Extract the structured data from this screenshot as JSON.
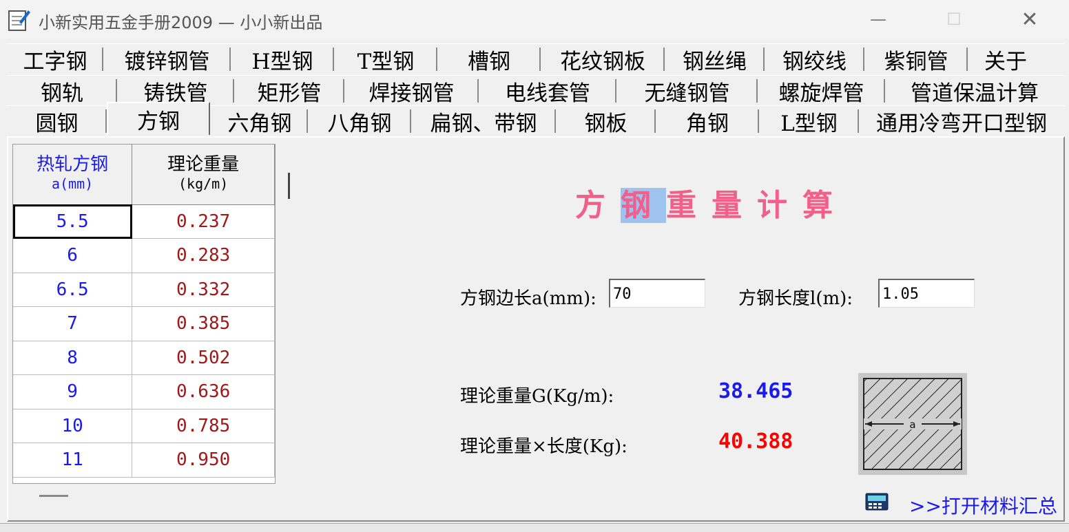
{
  "window": {
    "title": "小新实用五金手册2009 — 小小新出品",
    "minimize_glyph": "—",
    "maximize_glyph": "☐",
    "close_glyph": "✕"
  },
  "tabs": {
    "row1": [
      "工字钢",
      "镀锌钢管",
      "H型钢",
      "T型钢",
      "槽钢",
      "花纹钢板",
      "钢丝绳",
      "钢绞线",
      "紫铜管",
      "关于"
    ],
    "row2": [
      "钢轨",
      "铸铁管",
      "矩形管",
      "焊接钢管",
      "电线套管",
      "无缝钢管",
      "螺旋焊管",
      "管道保温计算"
    ],
    "row3": [
      "圆钢",
      "方钢",
      "六角钢",
      "八角钢",
      "扁钢、带钢",
      "钢板",
      "角钢",
      "L型钢",
      "通用冷弯开口型钢"
    ],
    "active": "方钢"
  },
  "table": {
    "header_col1": "热轧方钢",
    "header_col1_unit": "a(mm)",
    "header_col2": "理论重量",
    "header_col2_unit": "(kg/m)",
    "rows": [
      {
        "a": "5.5",
        "w": "0.237"
      },
      {
        "a": "6",
        "w": "0.283"
      },
      {
        "a": "6.5",
        "w": "0.332"
      },
      {
        "a": "7",
        "w": "0.385"
      },
      {
        "a": "8",
        "w": "0.502"
      },
      {
        "a": "9",
        "w": "0.636"
      },
      {
        "a": "10",
        "w": "0.785"
      },
      {
        "a": "11",
        "w": "0.950"
      }
    ]
  },
  "calculator": {
    "title_chars": [
      "方",
      "钢",
      "重",
      "量",
      "计",
      "算"
    ],
    "side_label": "方钢边长a(mm):",
    "side_value": "70",
    "length_label": "方钢长度l(m):",
    "length_value": "1.05",
    "weight_per_m_label": "理论重量G(Kg/m):",
    "weight_per_m_value": "38.465",
    "total_weight_label": "理论重量×长度(Kg):",
    "total_weight_value": "40.388",
    "diagram_label": "a"
  },
  "footer": {
    "link": ">>打开材料汇总"
  },
  "colors": {
    "title_pink": "#f0608a",
    "value_blue": "#1a1aee",
    "value_red": "#ff0000",
    "weight_text": "#a01818"
  }
}
